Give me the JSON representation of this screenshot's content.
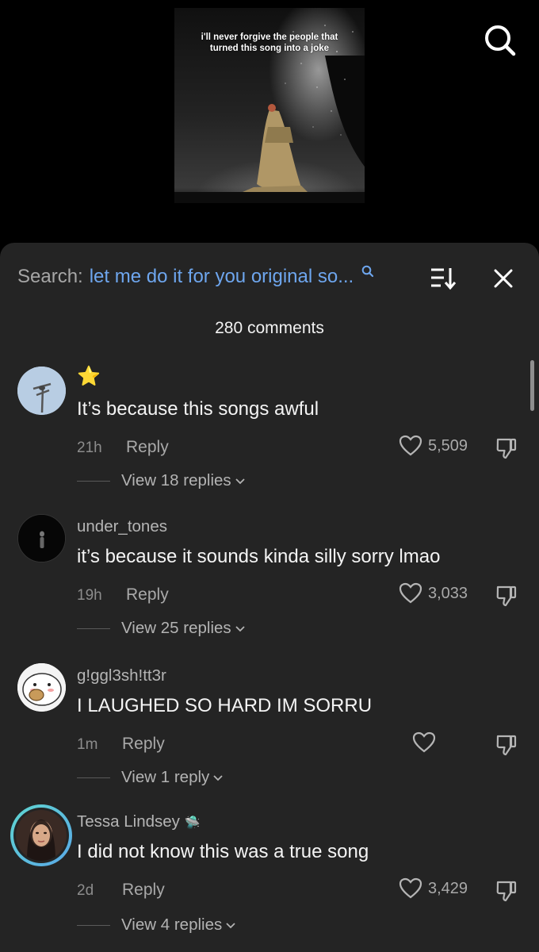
{
  "video": {
    "caption": "i'll never forgive the people that turned this song into a joke"
  },
  "search": {
    "prefix": "Search:",
    "query": "let me do it for you original so..."
  },
  "comment_count": "280 comments",
  "comments": [
    {
      "username": "",
      "badge": "⭐",
      "text": "It’s because this songs awful",
      "time": "21h",
      "reply_label": "Reply",
      "likes": "5,509",
      "view_replies": "View 18 replies"
    },
    {
      "username": "under_tones",
      "text": "it’s because it sounds kinda silly sorry lmao",
      "time": "19h",
      "reply_label": "Reply",
      "likes": "3,033",
      "view_replies": "View 25 replies"
    },
    {
      "username": "g!ggl3sh!tt3r",
      "text": "I LAUGHED SO HARD IM SORRU",
      "time": "1m",
      "reply_label": "Reply",
      "likes": "",
      "view_replies": "View 1 reply"
    },
    {
      "username": "Tessa Lindsey",
      "badge": "🛸",
      "text": "I did not know this was a true song",
      "time": "2d",
      "reply_label": "Reply",
      "likes": "3,429",
      "view_replies": "View 4 replies"
    }
  ]
}
